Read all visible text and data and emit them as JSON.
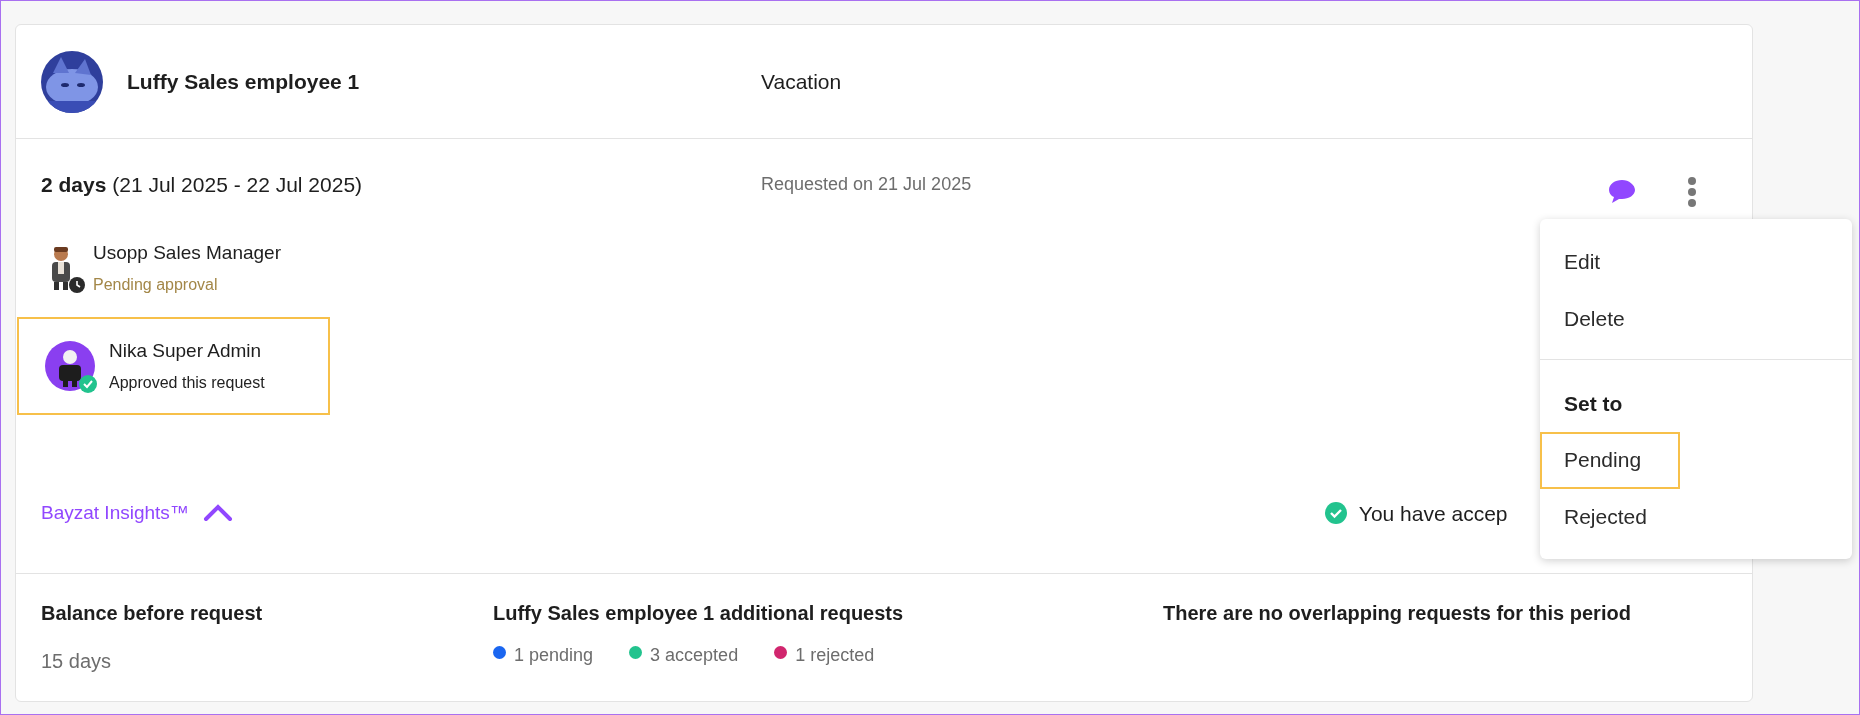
{
  "employee": {
    "name": "Luffy Sales employee 1"
  },
  "leave_type": "Vacation",
  "request": {
    "duration": "2 days",
    "period": "(21 Jul 2025 - 22 Jul 2025)",
    "requested_on": "Requested on 21 Jul 2025"
  },
  "approvers": [
    {
      "name": "Usopp Sales Manager",
      "status": "Pending approval",
      "kind": "pending",
      "highlighted": false
    },
    {
      "name": "Nika Super Admin",
      "status": "Approved this request",
      "kind": "approved",
      "highlighted": true
    }
  ],
  "insights": {
    "label": "Bayzat Insights™",
    "expanded": true
  },
  "acceptance_note": "You have accep",
  "menu": {
    "items": [
      {
        "label": "Edit",
        "highlighted": false
      },
      {
        "label": "Delete",
        "highlighted": false
      }
    ],
    "section": "Set to",
    "options": [
      {
        "label": "Pending",
        "highlighted": true
      },
      {
        "label": "Rejected",
        "highlighted": false
      }
    ]
  },
  "balance": {
    "title": "Balance before request",
    "value": "15 days"
  },
  "additional": {
    "title": "Luffy Sales employee 1 additional requests",
    "counts": [
      {
        "label": "1 pending",
        "color": "#1a66f0"
      },
      {
        "label": "3 accepted",
        "color": "#22c38e"
      },
      {
        "label": "1 rejected",
        "color": "#d1266e"
      }
    ]
  },
  "overlap": "There are no overlapping requests for this period"
}
